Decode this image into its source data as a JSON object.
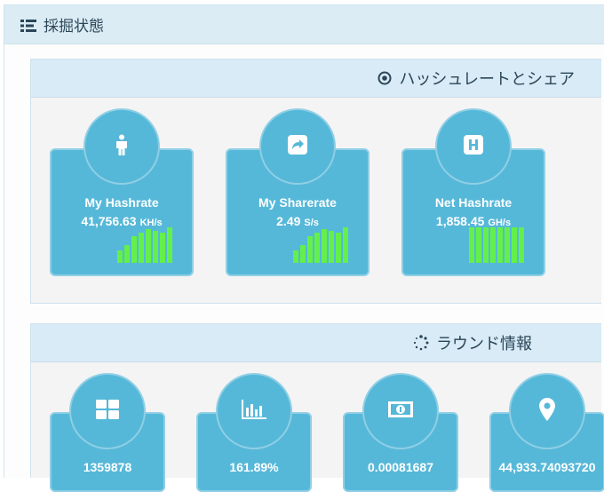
{
  "panel": {
    "title": "採掘状態",
    "icon": "list-icon"
  },
  "hashrate_section": {
    "title": "ハッシュレートとシェア",
    "icon": "target-icon",
    "cards": [
      {
        "label": "My Hashrate",
        "value": "41,756.63",
        "unit": "KH/s",
        "icon": "person-icon",
        "bars": [
          0.35,
          0.5,
          0.75,
          0.85,
          0.95,
          0.9,
          0.85,
          1.0
        ]
      },
      {
        "label": "My Sharerate",
        "value": "2.49",
        "unit": "S/s",
        "icon": "share-icon",
        "bars": [
          0.35,
          0.5,
          0.75,
          0.85,
          0.95,
          0.9,
          0.85,
          1.0
        ]
      },
      {
        "label": "Net Hashrate",
        "value": "1,858.45",
        "unit": "GH/s",
        "icon": "h-square-icon",
        "bars": [
          1.0,
          1.0,
          1.0,
          1.0,
          1.0,
          1.0,
          1.0,
          1.0
        ]
      }
    ]
  },
  "round_section": {
    "title": "ラウンド情報",
    "icon": "spinner-icon",
    "cards": [
      {
        "value": "1359878",
        "icon": "grid-icon"
      },
      {
        "value": "161.89%",
        "icon": "bar-chart-icon"
      },
      {
        "value": "0.00081687",
        "icon": "money-icon"
      },
      {
        "value": "44,933.74093720",
        "icon": "map-marker-icon"
      }
    ]
  },
  "colors": {
    "card": "#56b8d8",
    "card_border": "#8fcfe6",
    "bar": "#64f04a",
    "header": "#dbecf5"
  }
}
